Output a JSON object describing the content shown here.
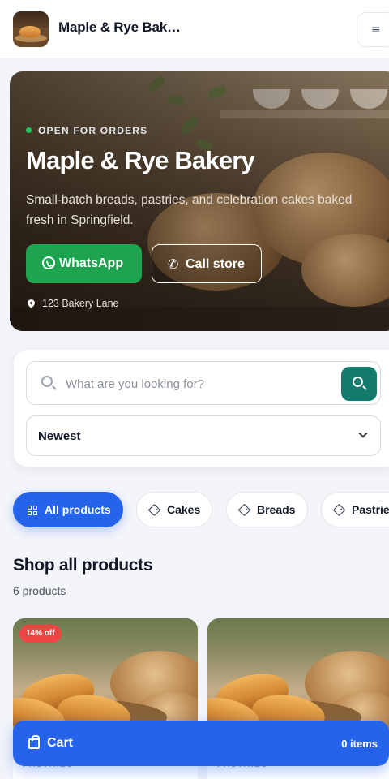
{
  "header": {
    "store_name": "Maple & Rye Bak…",
    "menu_icon": "≡"
  },
  "hero": {
    "status": "OPEN FOR ORDERS",
    "title": "Maple & Rye Bakery",
    "description": "Small-batch breads, pastries, and celebration cakes baked fresh in Springfield.",
    "whatsapp_label": "WhatsApp",
    "call_label": "Call store",
    "address": "123 Bakery Lane",
    "colors": {
      "whatsapp": "#1ea34e",
      "status_dot": "#22c55e"
    }
  },
  "filters": {
    "search_placeholder": "What are you looking for?",
    "sort_value": "Newest",
    "search_button_color": "#137a6e"
  },
  "categories": [
    {
      "label": "All products",
      "active": true,
      "icon": "grid-icon"
    },
    {
      "label": "Cakes",
      "active": false,
      "icon": "tag-icon"
    },
    {
      "label": "Breads",
      "active": false,
      "icon": "tag-icon"
    },
    {
      "label": "Pastries",
      "active": false,
      "icon": "tag-icon"
    }
  ],
  "products_section": {
    "title": "Shop all products",
    "count": "6 products"
  },
  "products": [
    {
      "badge": "14% off",
      "category": "PASTRIES"
    },
    {
      "badge": "",
      "category": "PASTRIES"
    }
  ],
  "cart": {
    "label": "Cart",
    "items": "0 items",
    "color": "#2563eb"
  }
}
